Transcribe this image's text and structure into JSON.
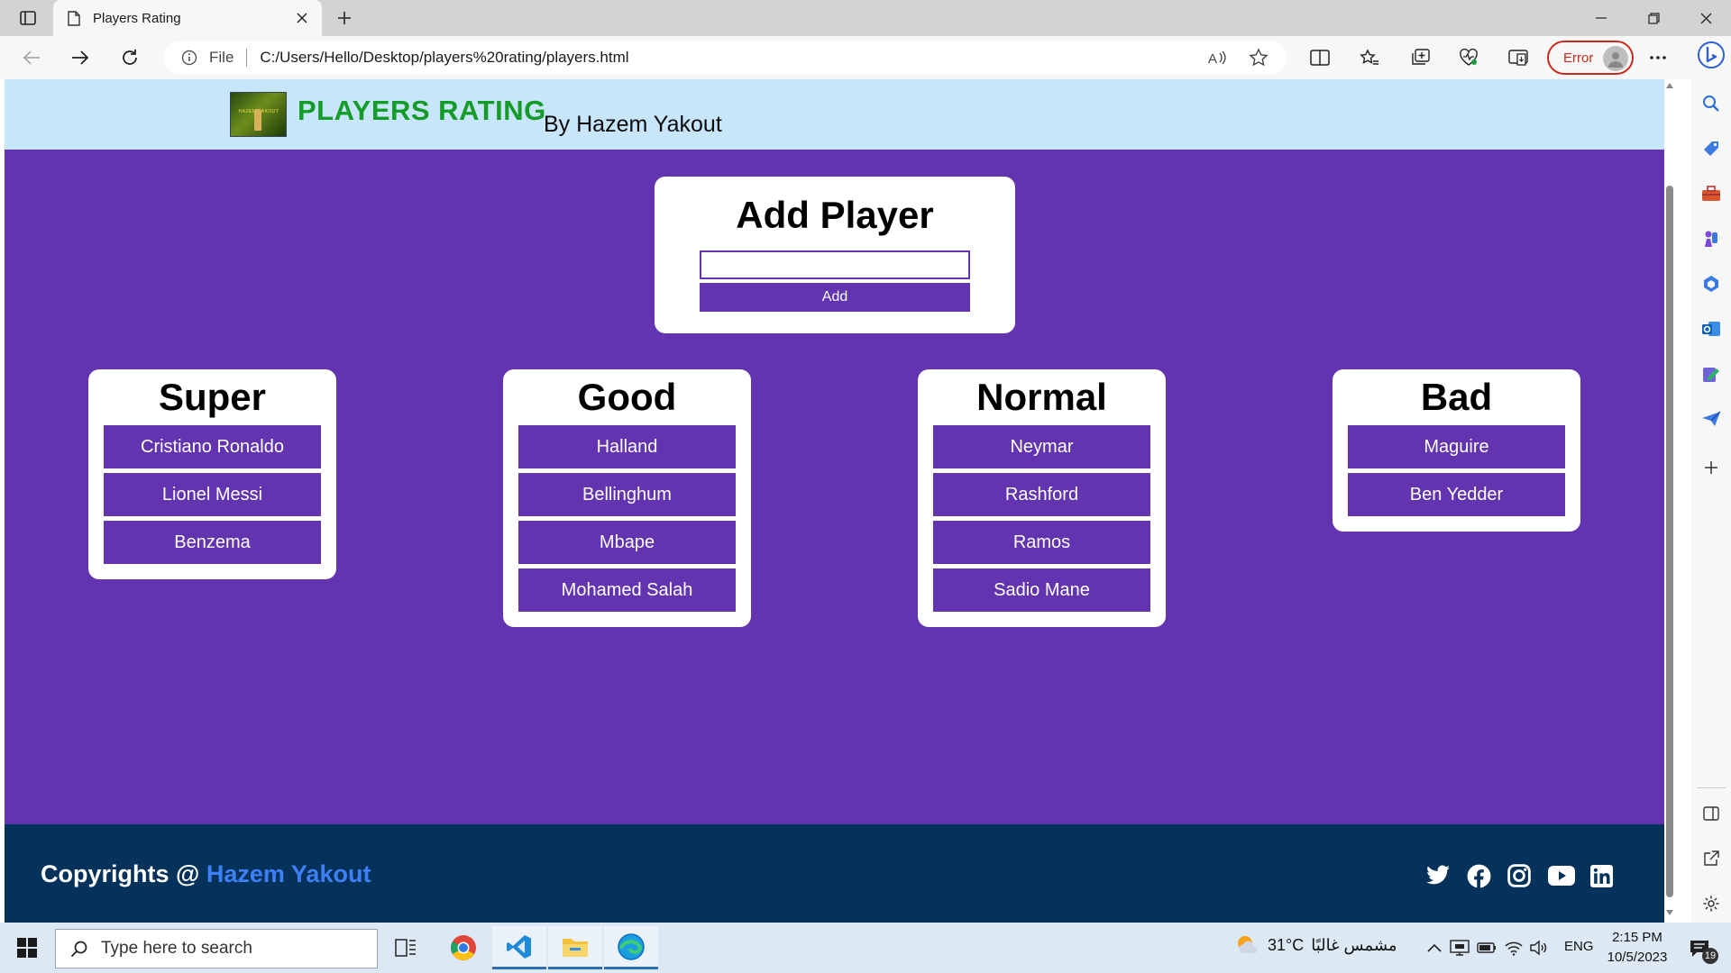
{
  "browser": {
    "tab_title": "Players Rating",
    "file_label": "File",
    "url": "C:/Users/Hello/Desktop/players%20rating/players.html",
    "error_label": "Error"
  },
  "header": {
    "logo_text": "HAZEM YAKOUT",
    "title": "PLAYERS RATING",
    "byline": "By Hazem Yakout"
  },
  "add_player": {
    "title": "Add Player",
    "input_value": "",
    "button_label": "Add"
  },
  "categories": [
    {
      "title": "Super",
      "players": [
        "Cristiano Ronaldo",
        "Lionel Messi",
        "Benzema"
      ]
    },
    {
      "title": "Good",
      "players": [
        "Halland",
        "Bellinghum",
        "Mbape",
        "Mohamed Salah"
      ]
    },
    {
      "title": "Normal",
      "players": [
        "Neymar",
        "Rashford",
        "Ramos",
        "Sadio Mane"
      ]
    },
    {
      "title": "Bad",
      "players": [
        "Maguire",
        "Ben Yedder"
      ]
    }
  ],
  "footer": {
    "copyright_prefix": "Copyrights @",
    "author": "Hazem Yakout",
    "social": [
      "twitter-icon",
      "facebook-icon",
      "instagram-icon",
      "youtube-icon",
      "linkedin-icon"
    ]
  },
  "taskbar": {
    "search_placeholder": "Type here to search",
    "weather_temp": "31°C",
    "weather_desc": "مشمس غالبًا",
    "language": "ENG",
    "time": "2:15 PM",
    "date": "10/5/2023",
    "notification_count": "19"
  },
  "colors": {
    "page_purple": "#6234b0",
    "header_blue": "#c8e6fb",
    "brand_green": "#159b28",
    "footer_navy": "#05325a",
    "author_blue": "#3d7ff5"
  }
}
